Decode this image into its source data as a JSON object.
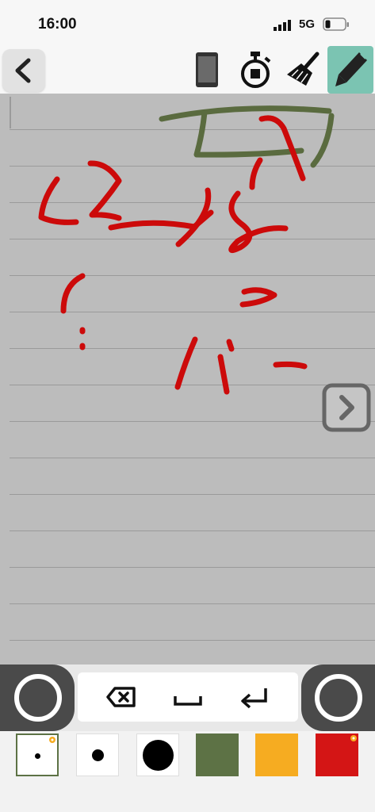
{
  "status_bar": {
    "time": "16:00",
    "network": "5G"
  },
  "toolbar": {
    "back": "back",
    "tools": [
      "phone-icon",
      "stopwatch-icon",
      "broom-icon",
      "pen-icon"
    ],
    "selected_tool": "pen",
    "selected_color": "#7bc4b2"
  },
  "canvas": {
    "background": "#bcbcbc",
    "ruled_lines": 15,
    "ink_colors": [
      "#cc0a0a",
      "#5a6b3f"
    ]
  },
  "keypad": {
    "keys": [
      "backspace-icon",
      "space-icon",
      "return-icon"
    ]
  },
  "palette": {
    "pen_sizes": [
      "small",
      "medium",
      "large"
    ],
    "selected_size": "small",
    "colors": [
      "#5d7245",
      "#f6ac21",
      "#d41515"
    ],
    "selected_color": "#d41515"
  }
}
